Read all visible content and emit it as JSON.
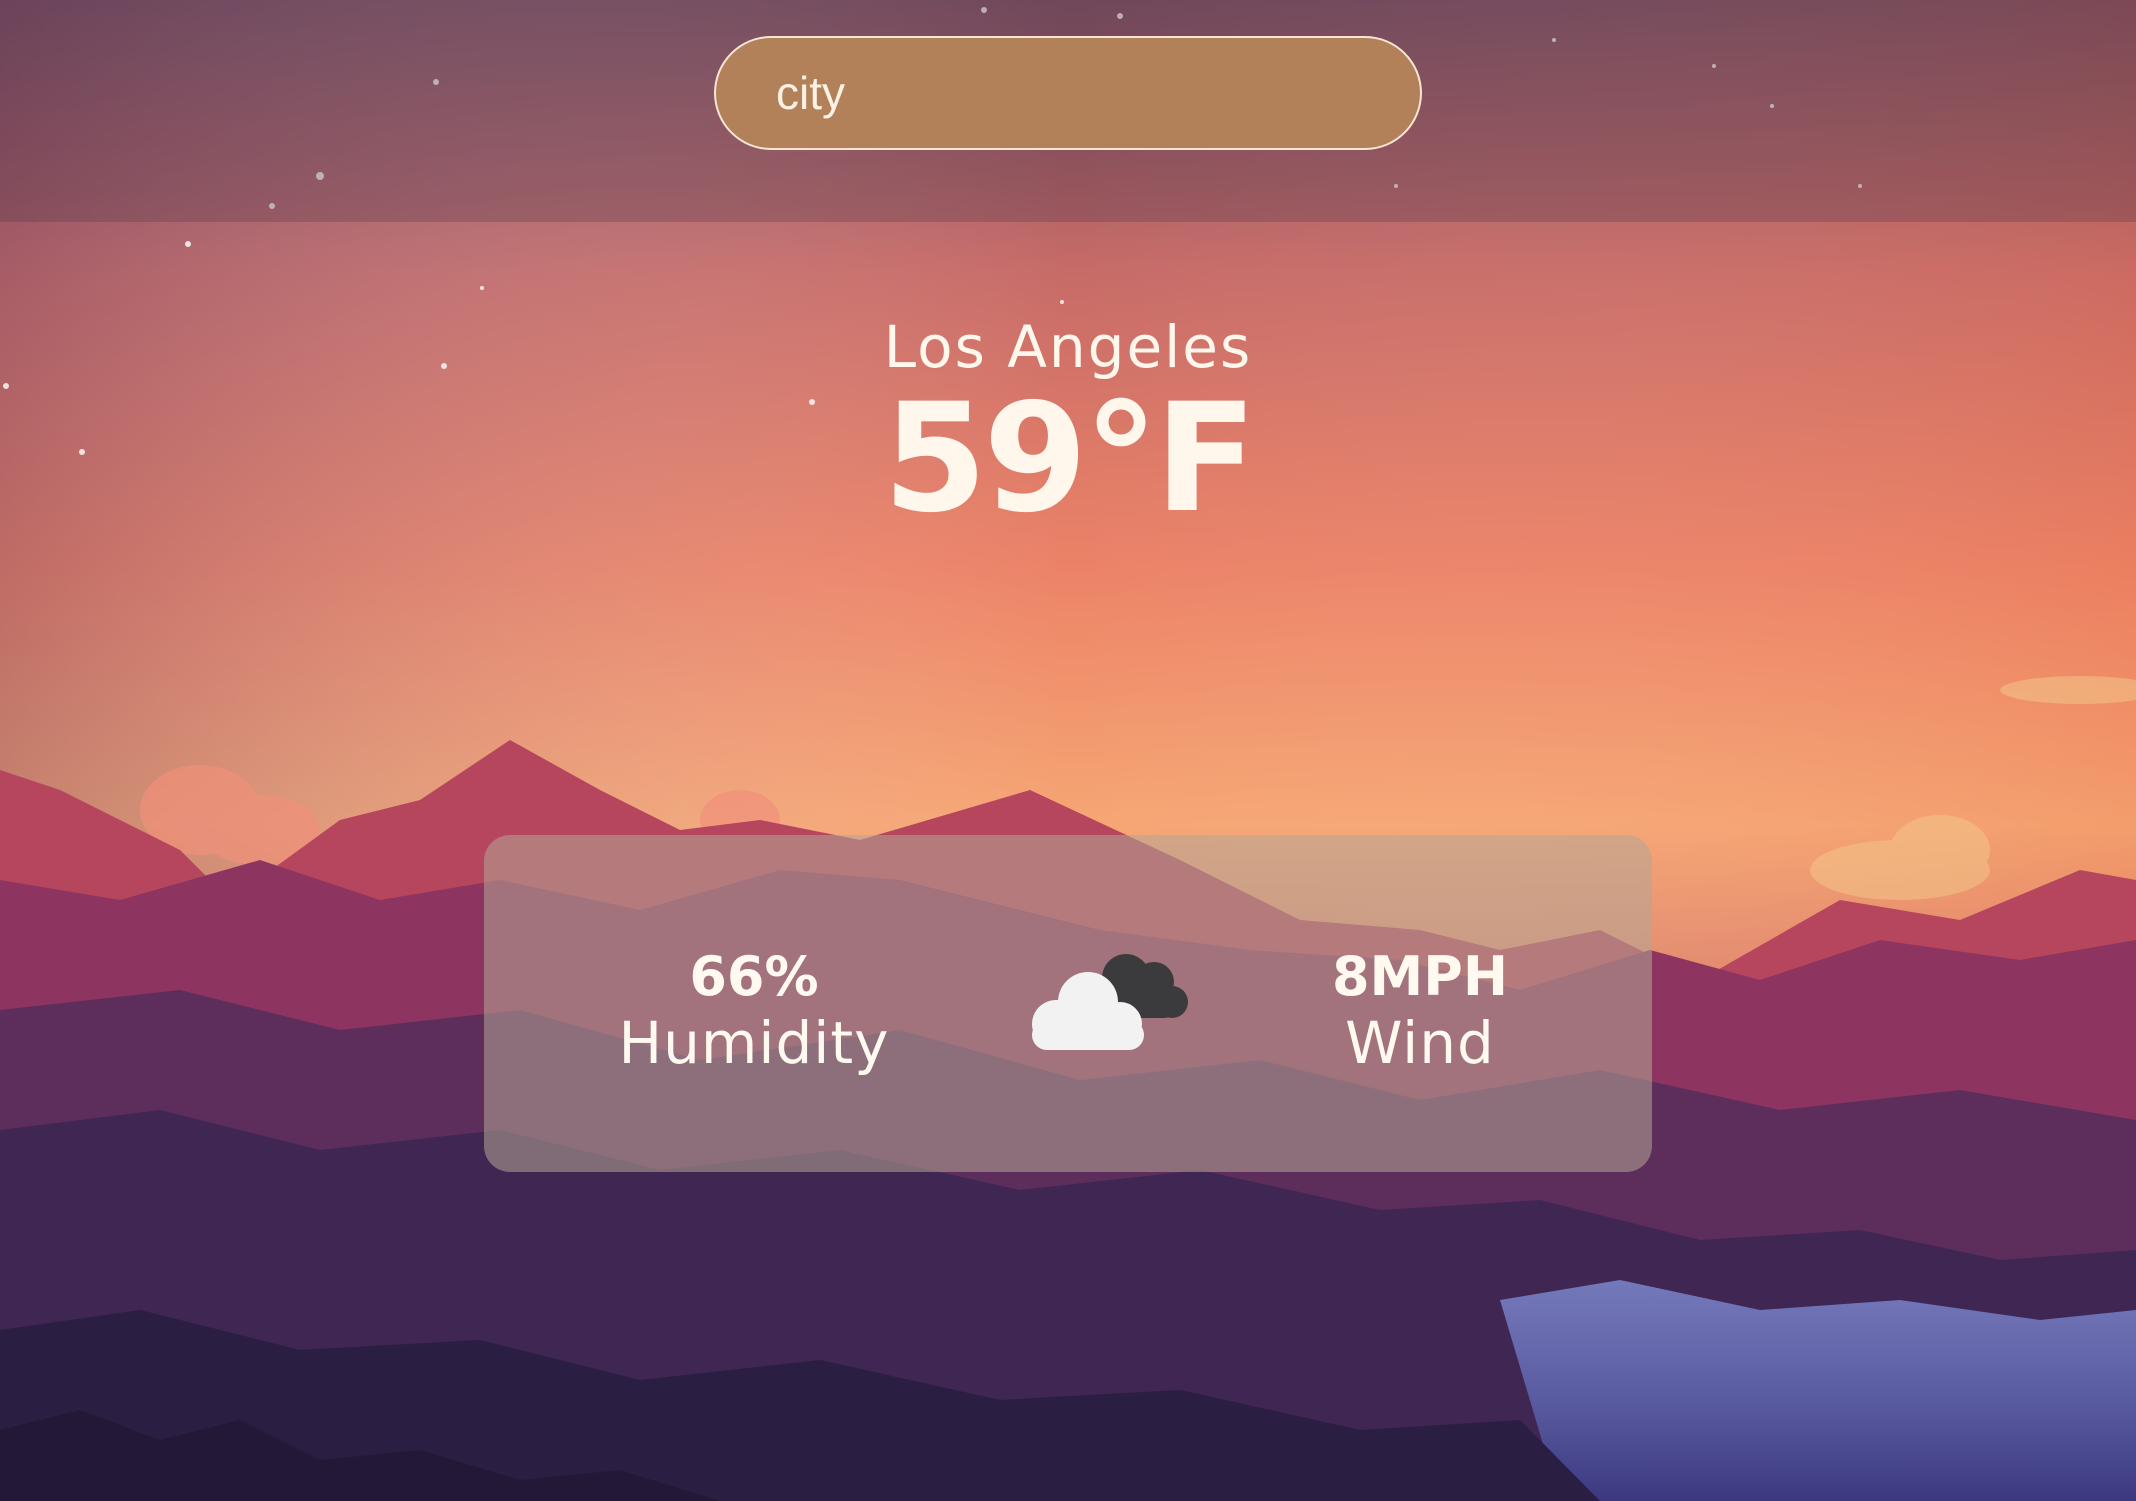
{
  "search": {
    "placeholder": "city",
    "value": ""
  },
  "weather": {
    "city": "Los Angeles",
    "temperature": "59°F",
    "humidity_value": "66%",
    "humidity_label": "Humidity",
    "wind_value": "8MPH",
    "wind_label": "Wind",
    "condition_icon": "cloudy-icon"
  },
  "colors": {
    "text": "#fff7ec",
    "search_bg": "#b38159",
    "card_bg": "rgba(180,165,150,0.55)"
  }
}
